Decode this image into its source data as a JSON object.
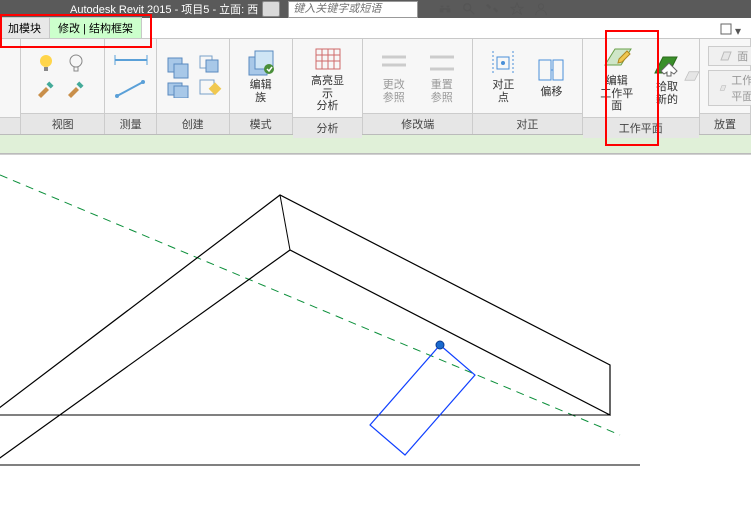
{
  "title": "Autodesk Revit 2015 -    项目5 - 立面: 西",
  "search_placeholder": "键入关键字或短语",
  "tabs": {
    "t0": "加模块",
    "t1": "修改 | 结构框架"
  },
  "panels": {
    "p1": "视图",
    "p2": "测量",
    "p3": "创建",
    "p4": "模式",
    "p5": "分析",
    "p6": "修改端",
    "p7": "对正",
    "p8": "工作平面",
    "p9": "放置"
  },
  "buttons": {
    "edit_family_1": "编辑",
    "edit_family_2": "族",
    "highlight_1": "高亮显示",
    "highlight_2": "分析",
    "change_ref_1": "更改",
    "change_ref_2": "参照",
    "reset_ref_1": "重置",
    "reset_ref_2": "参照",
    "align_1": "对正",
    "align_2": "点",
    "offset_1": "偏移",
    "offset_2": " ",
    "edit_wp_1": "编辑",
    "edit_wp_2": "工作平面",
    "pick_new_1": "拾取",
    "pick_new_2": "新的",
    "side_face": "面",
    "side_wp": "工作平面"
  }
}
